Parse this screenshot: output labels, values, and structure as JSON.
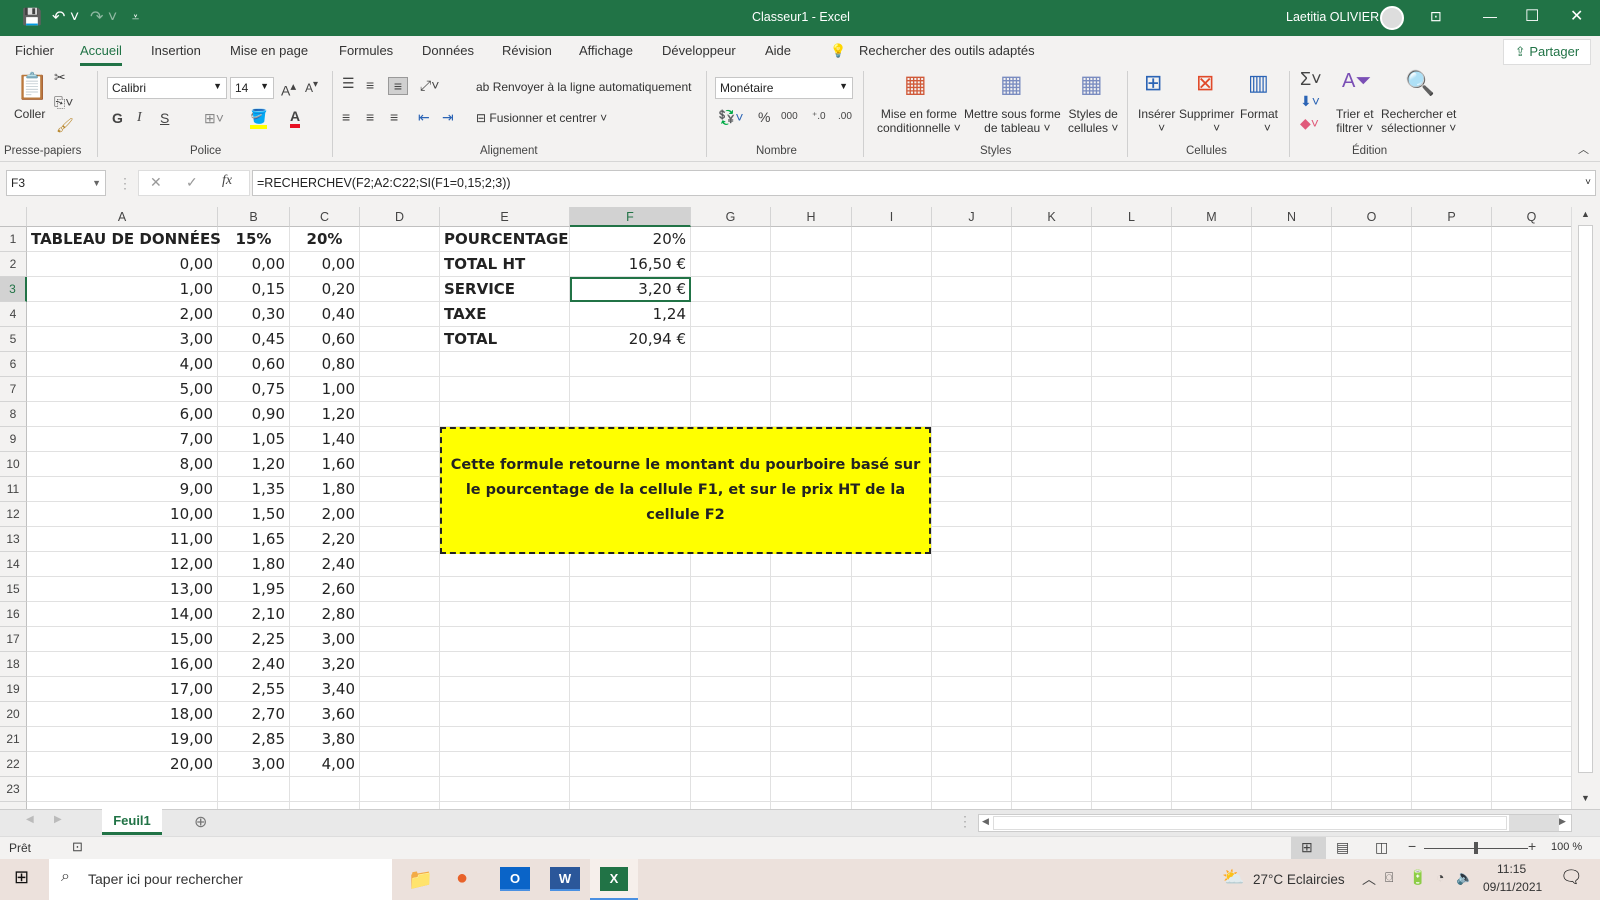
{
  "window": {
    "title": "Classeur1  -  Excel",
    "user": "Laetitia OLIVIER"
  },
  "menu": {
    "tabs": [
      "Fichier",
      "Accueil",
      "Insertion",
      "Mise en page",
      "Formules",
      "Données",
      "Révision",
      "Affichage",
      "Développeur",
      "Aide"
    ],
    "active": "Accueil",
    "search": "Rechercher des outils adaptés",
    "share": "Partager"
  },
  "ribbon": {
    "paste": "Coller",
    "clipboard_group": "Presse-papiers",
    "font_name": "Calibri",
    "font_size": "14",
    "bold": "G",
    "italic": "I",
    "underline": "S",
    "font_group": "Police",
    "wrap": "Renvoyer à la ligne automatiquement",
    "merge": "Fusionner et centrer",
    "align_group": "Alignement",
    "number_format": "Monétaire",
    "percent": "%",
    "thousands": "000",
    "number_group": "Nombre",
    "cond_format_1": "Mise en forme",
    "cond_format_2": "conditionnelle",
    "table_1": "Mettre sous forme",
    "table_2": "de tableau",
    "cellstyles_1": "Styles de",
    "cellstyles_2": "cellules",
    "styles_group": "Styles",
    "insert": "Insérer",
    "delete": "Supprimer",
    "format": "Format",
    "cells_group": "Cellules",
    "sort_1": "Trier et",
    "sort_2": "filtrer",
    "find_1": "Rechercher et",
    "find_2": "sélectionner",
    "edit_group": "Édition",
    "colors": {
      "accent": "#217346",
      "font_color": "#e81123",
      "highlight": "#ffff00"
    }
  },
  "formula_bar": {
    "name_box": "F3",
    "formula": "=RECHERCHEV(F2;A2:C22;SI(F1=0,15;2;3))"
  },
  "sheet": {
    "columns": [
      "A",
      "B",
      "C",
      "D",
      "E",
      "F",
      "G",
      "H",
      "I",
      "J",
      "K",
      "L",
      "M",
      "N",
      "O",
      "P",
      "Q"
    ],
    "selected_cell": "F3",
    "rows": [
      {
        "A": "TABLEAU DE DONNÉES",
        "B": "15%",
        "C": "20%",
        "E": "POURCENTAGE",
        "F": "20%"
      },
      {
        "A": "0,00",
        "B": "0,00",
        "C": "0,00",
        "E": "TOTAL HT",
        "F": "16,50 €"
      },
      {
        "A": "1,00",
        "B": "0,15",
        "C": "0,20",
        "E": "SERVICE",
        "F": "3,20 €"
      },
      {
        "A": "2,00",
        "B": "0,30",
        "C": "0,40",
        "E": "TAXE",
        "F": "1,24"
      },
      {
        "A": "3,00",
        "B": "0,45",
        "C": "0,60",
        "E": "TOTAL",
        "F": "20,94 €"
      },
      {
        "A": "4,00",
        "B": "0,60",
        "C": "0,80"
      },
      {
        "A": "5,00",
        "B": "0,75",
        "C": "1,00"
      },
      {
        "A": "6,00",
        "B": "0,90",
        "C": "1,20"
      },
      {
        "A": "7,00",
        "B": "1,05",
        "C": "1,40"
      },
      {
        "A": "8,00",
        "B": "1,20",
        "C": "1,60"
      },
      {
        "A": "9,00",
        "B": "1,35",
        "C": "1,80"
      },
      {
        "A": "10,00",
        "B": "1,50",
        "C": "2,00"
      },
      {
        "A": "11,00",
        "B": "1,65",
        "C": "2,20"
      },
      {
        "A": "12,00",
        "B": "1,80",
        "C": "2,40"
      },
      {
        "A": "13,00",
        "B": "1,95",
        "C": "2,60"
      },
      {
        "A": "14,00",
        "B": "2,10",
        "C": "2,80"
      },
      {
        "A": "15,00",
        "B": "2,25",
        "C": "3,00"
      },
      {
        "A": "16,00",
        "B": "2,40",
        "C": "3,20"
      },
      {
        "A": "17,00",
        "B": "2,55",
        "C": "3,40"
      },
      {
        "A": "18,00",
        "B": "2,70",
        "C": "3,60"
      },
      {
        "A": "19,00",
        "B": "2,85",
        "C": "3,80"
      },
      {
        "A": "20,00",
        "B": "3,00",
        "C": "4,00"
      },
      {}
    ],
    "note": "Cette formule retourne le montant du pourboire basé sur le pourcentage de la cellule F1, et sur le prix HT de la cellule F2",
    "note_color": "#ffff00",
    "sheet_tab": "Feuil1"
  },
  "status": {
    "ready": "Prêt",
    "zoom": "100 %",
    "zoom_percent": 100
  },
  "taskbar": {
    "search": "Taper ici pour rechercher",
    "weather": "27°C  Eclaircies",
    "time": "11:15",
    "date": "09/11/2021"
  }
}
